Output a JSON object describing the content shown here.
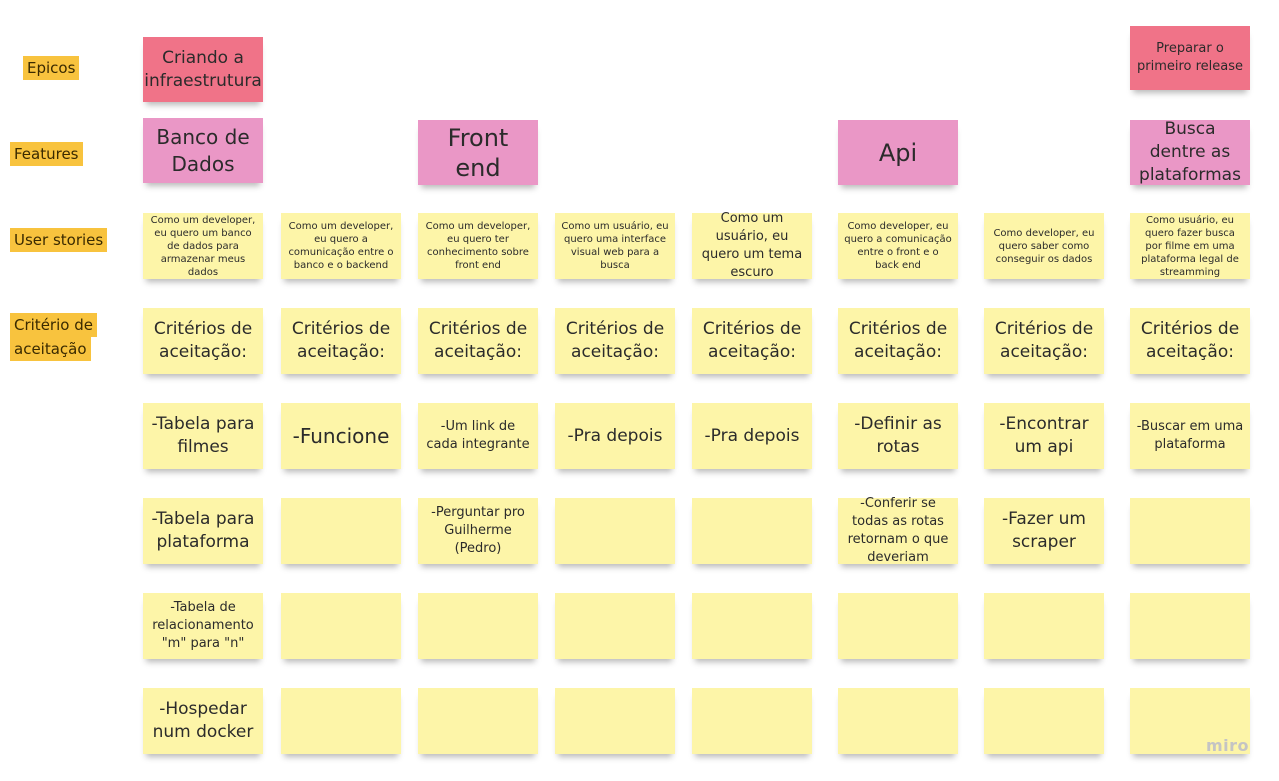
{
  "row_labels": {
    "epicos": "Epicos",
    "features": "Features",
    "user_stories": "User stories",
    "criterio_line1": "Critério de",
    "criterio_line2": "aceitação"
  },
  "epics": {
    "e1": "Criando a infraestrutura",
    "e2": "Preparar o primeiro release"
  },
  "features": {
    "f1": "Banco de Dados",
    "f2": "Front end",
    "f3": "Api",
    "f4": "Busca dentre as plataformas"
  },
  "stories": {
    "s1": "Como um developer, eu quero um banco de dados para armazenar meus dados",
    "s2": "Como um developer, eu quero a comunicação entre o banco e o backend",
    "s3": "Como um developer, eu quero ter conhecimento sobre front end",
    "s4": "Como um usuário, eu quero uma interface visual web para a busca",
    "s5": "Como um usuário, eu quero um tema escuro",
    "s6": "Como developer, eu quero a comunicação entre o front e o back end",
    "s7": "Como developer, eu quero saber como conseguir os dados",
    "s8": "Como usuário, eu quero fazer busca por filme em uma plataforma legal de streamming"
  },
  "criteria_header": "Critérios de aceitação:",
  "criteria": {
    "c1_1": "-Tabela para filmes",
    "c1_2": "-Tabela para plataforma",
    "c1_3": "-Tabela de relacionamento \"m\" para \"n\"",
    "c1_4": "-Hospedar num docker",
    "c2_1": "-Funcione",
    "c3_1": "-Um link de cada integrante",
    "c3_2": "-Perguntar pro Guilherme (Pedro)",
    "c4_1": "-Pra depois",
    "c5_1": "-Pra depois",
    "c6_1": "-Definir as rotas",
    "c6_2": "-Conferir se todas as rotas retornam o que deveriam",
    "c7_1": "-Encontrar um api",
    "c7_2": "-Fazer um scraper",
    "c8_1": "-Buscar em uma plataforma"
  },
  "watermark": "miro",
  "colors": {
    "sticky_yellow": "#fdf5a8",
    "sticky_red": "#f07388",
    "sticky_pink": "#ea97c6",
    "label_yellow": "#f8c33e"
  }
}
